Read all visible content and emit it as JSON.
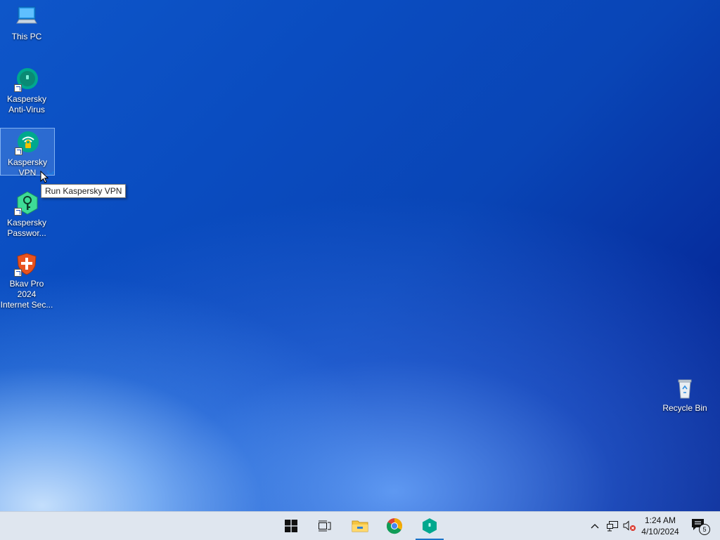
{
  "desktop": {
    "icons": [
      {
        "line1": "This PC",
        "line2": ""
      },
      {
        "line1": "Kaspersky",
        "line2": "Anti-Virus"
      },
      {
        "line1": "Kaspersky",
        "line2": "VPN"
      },
      {
        "line1": "Kaspersky",
        "line2": "Passwor..."
      },
      {
        "line1": "Bkav Pro 2024",
        "line2": "Internet Sec..."
      }
    ],
    "recycle_bin": "Recycle Bin",
    "tooltip": "Run Kaspersky VPN"
  },
  "taskbar": {
    "start_icon": "windows-logo-icon",
    "task_view_icon": "task-view-icon",
    "pinned": [
      "file-explorer-icon",
      "chrome-icon",
      "kaspersky-icon"
    ],
    "active_app": "kaspersky-icon",
    "tray_icons": [
      "chevron-up-icon",
      "network-icon",
      "volume-muted-icon"
    ],
    "clock": {
      "time": "1:24 AM",
      "date": "4/10/2024"
    },
    "notifications": {
      "count": "5"
    }
  },
  "colors": {
    "kaspersky_green": "#00a88e",
    "taskbar_bg": "#dfe6ef",
    "accent": "#1a73c8"
  }
}
